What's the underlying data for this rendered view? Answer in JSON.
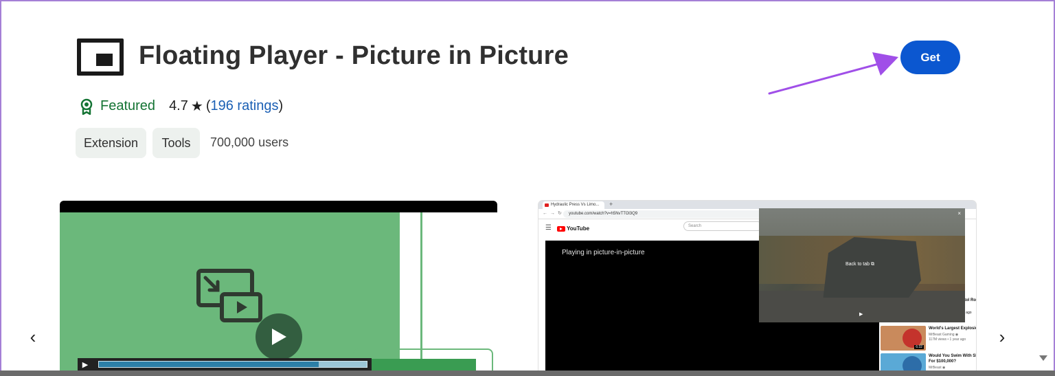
{
  "title": "Floating Player - Picture in Picture",
  "get_button": "Get",
  "meta": {
    "featured": "Featured",
    "rating": "4.7",
    "star": "★",
    "ratings_open": "(",
    "ratings_link": "196 ratings",
    "ratings_close": ")"
  },
  "chips": [
    "Extension",
    "Tools"
  ],
  "users": "700,000 users",
  "nav": {
    "prev": "‹",
    "next": "›"
  },
  "screenshot2": {
    "tab_title": "Hydraulic Press Vs Limo...",
    "new_tab": "+",
    "url": "youtube.com/watch?v=h5NvTTOl3Q9",
    "search_placeholder": "Search",
    "yt_logo_text": "YouTube",
    "playing_text": "Playing in picture-in-picture",
    "pip_close": "×",
    "pip_back": "Back to tab ⧉",
    "pip_play": "▶",
    "side_fragment_1": "tol Ro",
    "side_fragment_2": "e ago",
    "side_items": [
      {
        "title": "World's Largest Explosion",
        "channel": "MrBeast Gaming ◉",
        "stats": "117M views • 1 year ago",
        "duration": "6:32"
      },
      {
        "title": "Would You Swim With Sha",
        "channel": "For $100,000?",
        "stats": "MrBeast ◉",
        "duration": ""
      }
    ]
  },
  "colors": {
    "accent": "#0b57d0",
    "featured_green": "#137333",
    "link_blue": "#1a5fb4",
    "chip_bg": "#edf1ee",
    "arrow_purple": "#a04fe8",
    "shot1_green": "#6bb87b"
  },
  "icons": {
    "logo": "picture-in-picture-icon",
    "featured": "award-badge-icon",
    "star": "star-icon",
    "prev": "chevron-left-icon",
    "next": "chevron-right-icon",
    "play": "play-icon"
  }
}
